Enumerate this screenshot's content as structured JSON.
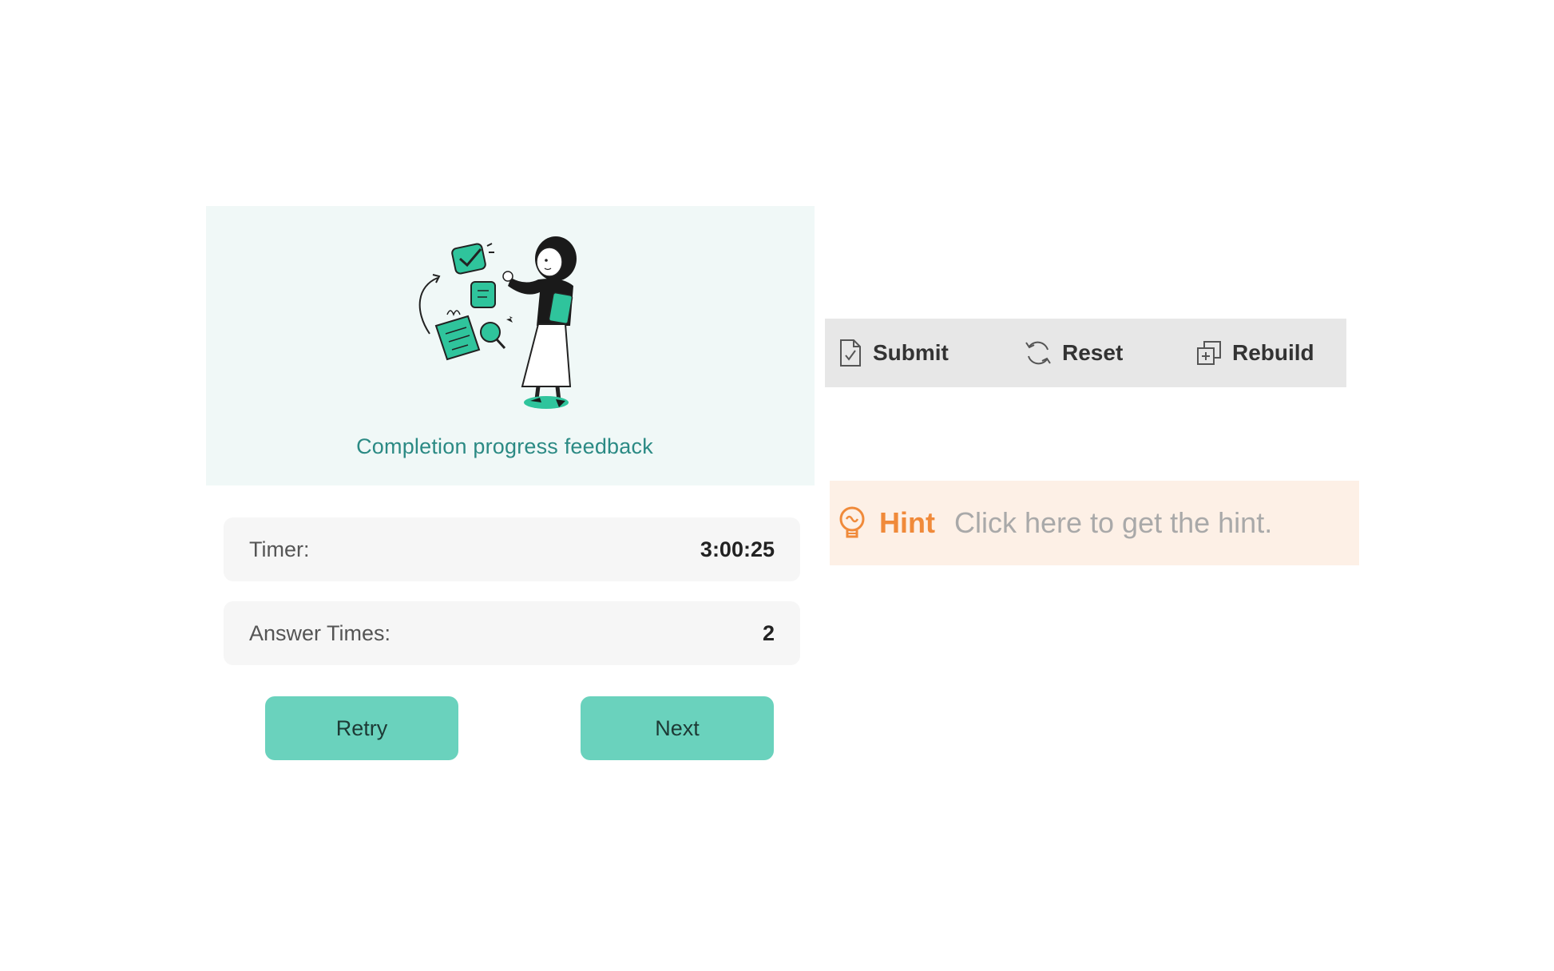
{
  "feedback": {
    "title": "Completion progress feedback",
    "illustration_icon": "woman-with-checklist-illustration"
  },
  "stats": {
    "timer_label": "Timer:",
    "timer_value": "3:00:25",
    "answer_times_label": "Answer Times:",
    "answer_times_value": "2"
  },
  "actions": {
    "retry_label": "Retry",
    "next_label": "Next"
  },
  "toolbar": {
    "submit_label": "Submit",
    "submit_icon": "document-check-icon",
    "reset_label": "Reset",
    "reset_icon": "refresh-icon",
    "rebuild_label": "Rebuild",
    "rebuild_icon": "copy-plus-icon"
  },
  "hint": {
    "label": "Hint",
    "text": "Click here to get the hint.",
    "icon": "lightbulb-icon"
  },
  "colors": {
    "accent_teal": "#6ad2bd",
    "title_teal": "#2b8a84",
    "banner_bg": "#f0f8f7",
    "hint_orange": "#f08a3a",
    "hint_bg": "#fdf0e6",
    "toolbar_bg": "#e7e7e7"
  }
}
